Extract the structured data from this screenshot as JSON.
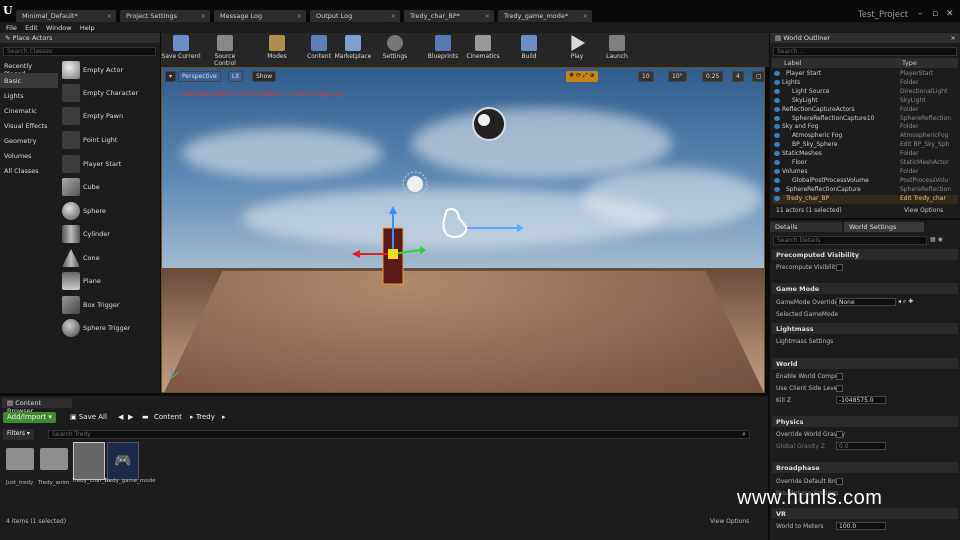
{
  "titlebar": {
    "logo": "U",
    "project": "Test_Project",
    "tabs": [
      "Minimal_Default*",
      "Project Settings",
      "Message Log",
      "Output Log",
      "Tredy_char_BP*",
      "Tredy_game_mode*"
    ]
  },
  "menu": [
    "File",
    "Edit",
    "Window",
    "Help"
  ],
  "place": {
    "title": "Place Actors",
    "search": "Search Classes",
    "cats": [
      "Recently Placed",
      "Basic",
      "Lights",
      "Cinematic",
      "Visual Effects",
      "Geometry",
      "Volumes",
      "All Classes"
    ],
    "items": [
      "Empty Actor",
      "Empty Character",
      "Empty Pawn",
      "Point Light",
      "Player Start",
      "Cube",
      "Sphere",
      "Cylinder",
      "Cone",
      "Plane",
      "Box Trigger",
      "Sphere Trigger"
    ]
  },
  "toolbar": [
    "Save Current",
    "Source Control",
    "Modes",
    "Content",
    "Marketplace",
    "Settings",
    "Blueprints",
    "Cinematics",
    "Build",
    "Play",
    "Launch"
  ],
  "viewport": {
    "perspective": "Perspective",
    "lit": "Lit",
    "show": "Show",
    "grid": "10",
    "angle": "10°",
    "scale": "0.25",
    "cam": "4",
    "warning": "LIGHTING NEEDS TO BE REBUILT (3 unbuilt objects)"
  },
  "outliner": {
    "title": "World Outliner",
    "search": "Search...",
    "col_label": "Label",
    "col_type": "Type",
    "rows": [
      {
        "name": "Player Start",
        "type": "PlayerStart",
        "indent": 14
      },
      {
        "name": "Lights",
        "type": "Folder",
        "indent": 10
      },
      {
        "name": "Light Source",
        "type": "DirectionalLight",
        "indent": 20
      },
      {
        "name": "SkyLight",
        "type": "SkyLight",
        "indent": 20
      },
      {
        "name": "ReflectionCaptureActors",
        "type": "Folder",
        "indent": 10
      },
      {
        "name": "SphereReflectionCapture10",
        "type": "SphereReflection",
        "indent": 20
      },
      {
        "name": "Sky and Fog",
        "type": "Folder",
        "indent": 10
      },
      {
        "name": "Atmospheric Fog",
        "type": "AtmosphericFog",
        "indent": 20
      },
      {
        "name": "BP_Sky_Sphere",
        "type": "Edit BP_Sky_Sph",
        "indent": 20
      },
      {
        "name": "StaticMeshes",
        "type": "Folder",
        "indent": 10
      },
      {
        "name": "Floor",
        "type": "StaticMeshActor",
        "indent": 20
      },
      {
        "name": "Volumes",
        "type": "Folder",
        "indent": 10
      },
      {
        "name": "GlobalPostProcessVolume",
        "type": "PostProcessVolu",
        "indent": 20
      },
      {
        "name": "SphereReflectionCapture",
        "type": "SphereReflection",
        "indent": 14
      },
      {
        "name": "Tredy_char_BP",
        "type": "Edit Tredy_char",
        "indent": 14
      }
    ],
    "count": "11 actors (1 selected)",
    "view": "View Options"
  },
  "details": {
    "tab1": "Details",
    "tab2": "World Settings",
    "search": "Search Details",
    "s1": "Precomputed Visibility",
    "p1": "Precompute Visibility",
    "s2": "Game Mode",
    "p2": "GameMode Override",
    "p2v": "None",
    "p3": "Selected GameMode",
    "s3": "Lightmass",
    "p4": "Lightmass Settings",
    "s4": "World",
    "p5": "Enable World Compos",
    "p6": "Use Client Side Level",
    "p7": "Kill Z",
    "p7v": "-1048575.0",
    "s5": "Physics",
    "p8": "Override World Gravity",
    "p9": "Global Gravity Z",
    "p9v": "0.0",
    "s6": "Broadphase",
    "p10": "Override Default Broa",
    "p11": "Broadphase Settings",
    "s7": "VR",
    "p12": "World to Meters",
    "p12v": "100.0"
  },
  "content": {
    "title": "Content Browser",
    "add": "Add/Import",
    "saveall": "Save All",
    "crumb1": "Content",
    "crumb2": "Tredy",
    "filters": "Filters",
    "search": "Search Tredy",
    "assets": [
      "Just_tredy",
      "Tredy_anim",
      "Tredy_char_BP",
      "Tredy_game_mode"
    ],
    "count": "4 items (1 selected)",
    "view": "View Options"
  },
  "watermark": "www.hunls.com"
}
